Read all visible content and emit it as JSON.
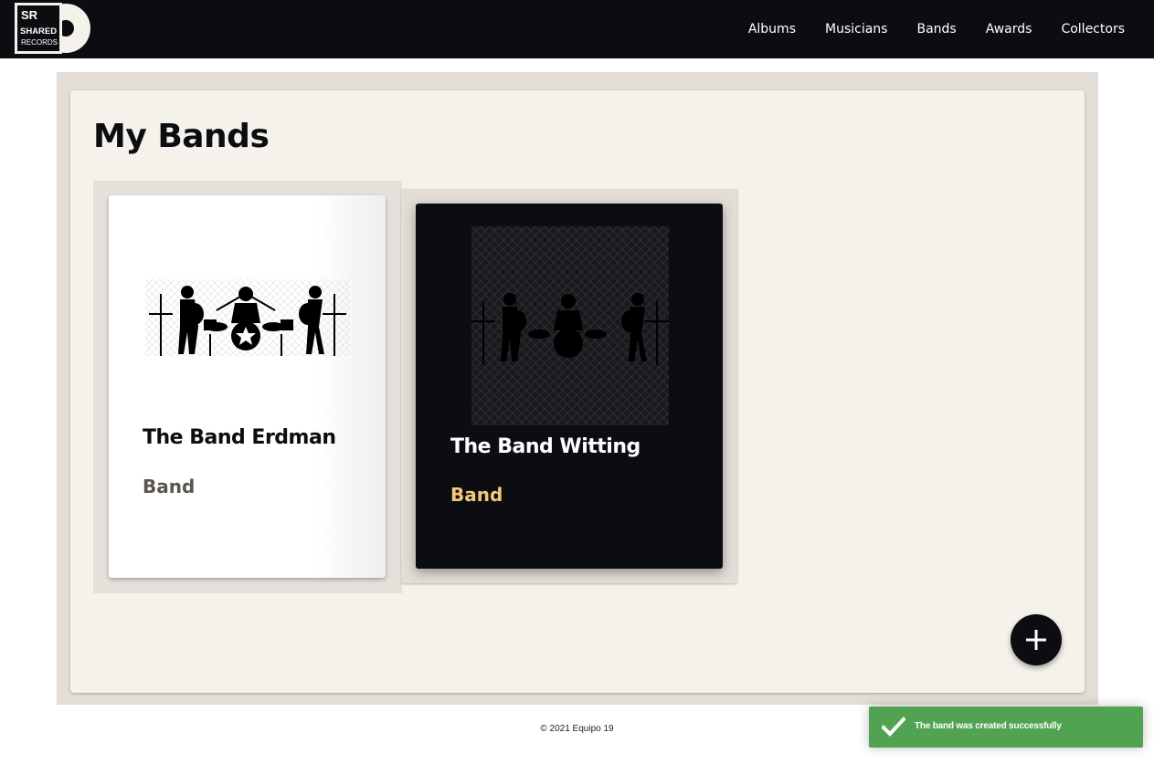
{
  "nav": {
    "logo_text_line1": "SR",
    "logo_text_line2": "SHARED",
    "logo_text_line3": "RECORDS",
    "links": [
      {
        "label": "Albums"
      },
      {
        "label": "Musicians"
      },
      {
        "label": "Bands"
      },
      {
        "label": "Awards"
      },
      {
        "label": "Collectors"
      }
    ]
  },
  "main": {
    "title": "My Bands",
    "cards": [
      {
        "name": "The Band Erdman",
        "type": "Band",
        "image": "band-silhouette-icon",
        "theme": "light"
      },
      {
        "name": "The Band Witting",
        "type": "Band",
        "image": "band-silhouette-icon",
        "theme": "dark"
      }
    ],
    "fab_icon": "plus-icon"
  },
  "footer": {
    "text": "© 2021 Equipo 19"
  },
  "toast": {
    "message": "The band was created successfully",
    "icon": "check-icon",
    "color": "#51a351"
  },
  "colors": {
    "navbar": "#0c0d11",
    "panel": "#f5f1eb",
    "accent_gold": "#f3c97a"
  }
}
